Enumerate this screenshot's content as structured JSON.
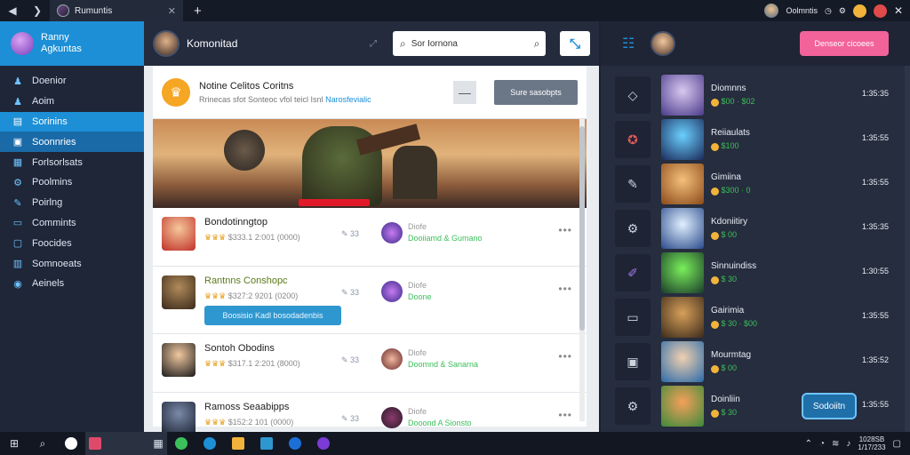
{
  "titlebar": {
    "tab_title": "Rumuntis",
    "close_glyph": "✕",
    "new_tab_glyph": "+",
    "right_label": "Oolmntis"
  },
  "sidebar": {
    "profile_name_line1": "Ranny",
    "profile_name_line2": "Agkuntas",
    "items": [
      {
        "label": "Doenior",
        "icon": "person-icon"
      },
      {
        "label": "Aoim",
        "icon": "person-icon"
      },
      {
        "label": "Sorinins",
        "icon": "chart-icon"
      },
      {
        "label": "Soonnries",
        "icon": "chat-icon"
      },
      {
        "label": "Forlsorlsats",
        "icon": "image-icon"
      },
      {
        "label": "Poolmins",
        "icon": "gear-icon"
      },
      {
        "label": "Poirlng",
        "icon": "pin-icon"
      },
      {
        "label": "Commints",
        "icon": "monitor-icon"
      },
      {
        "label": "Foocides",
        "icon": "box-icon"
      },
      {
        "label": "Somnoeats",
        "icon": "chart-icon"
      },
      {
        "label": "Aeinels",
        "icon": "eye-icon"
      }
    ]
  },
  "main": {
    "title": "Komonitad",
    "search_value": "Sor Iornona",
    "notice": {
      "title": "Notine Celitos Coritns",
      "body": "Rrinecas sfot Sonteoc vfol teicl Isnl",
      "link": "Narosfevialic",
      "button": "Sure sasobpts"
    },
    "feed": [
      {
        "name": "Bondotinngtop",
        "meta": "$333.1 2:001 (0000)",
        "comments": "33",
        "sub1": "Diofe",
        "sub2": "Dooiiamd & Gumano"
      },
      {
        "name": "Rantnns Conshopc",
        "meta": "$327:2 9201 (0200)",
        "comments": "33",
        "sub1": "Diofe",
        "sub2": "Doone",
        "action": "Boosisio Kadl bosodadenbis"
      },
      {
        "name": "Sontoh Obodins",
        "meta": "$317.1 2:201 (8000)",
        "comments": "33",
        "sub1": "Diofe",
        "sub2": "Doomnd & Sanarna"
      },
      {
        "name": "Ramoss Seaabipps",
        "meta": "$152:2 101 (0000)",
        "comments": "33",
        "sub1": "Diofe",
        "sub2": "Dooond A Sionsto"
      }
    ]
  },
  "right": {
    "pill_label": "Denseor cicoees",
    "items": [
      {
        "title": "Diomnns",
        "sub": "$00 · $02",
        "time": "1:35:35"
      },
      {
        "title": "Reiiaulats",
        "sub": "$100",
        "time": "1:35:55"
      },
      {
        "title": "Gimiina",
        "sub": "$300 · 0",
        "time": "1:35:55"
      },
      {
        "title": "Kdoniitiry",
        "sub": "$ 00",
        "time": "1:35:35"
      },
      {
        "title": "Sinnuindiss",
        "sub": "$ 30",
        "time": "1:30:55"
      },
      {
        "title": "Gairimia",
        "sub": "$ 30 · $00",
        "time": "1:35:55"
      },
      {
        "title": "Mourmtag",
        "sub": "$ 00",
        "time": "1:35:52"
      },
      {
        "title": "Doinliin",
        "sub": "$ 30",
        "time": "1:35:55"
      }
    ],
    "float_button": "Sodoiitn"
  },
  "taskbar": {
    "clock_line1": "1028SB",
    "clock_line2": "1/17/233"
  },
  "colors": {
    "accent": "#1c8fd6",
    "pill": "#f2639a",
    "positive": "#3bbf5a",
    "warn": "#f5a623"
  }
}
